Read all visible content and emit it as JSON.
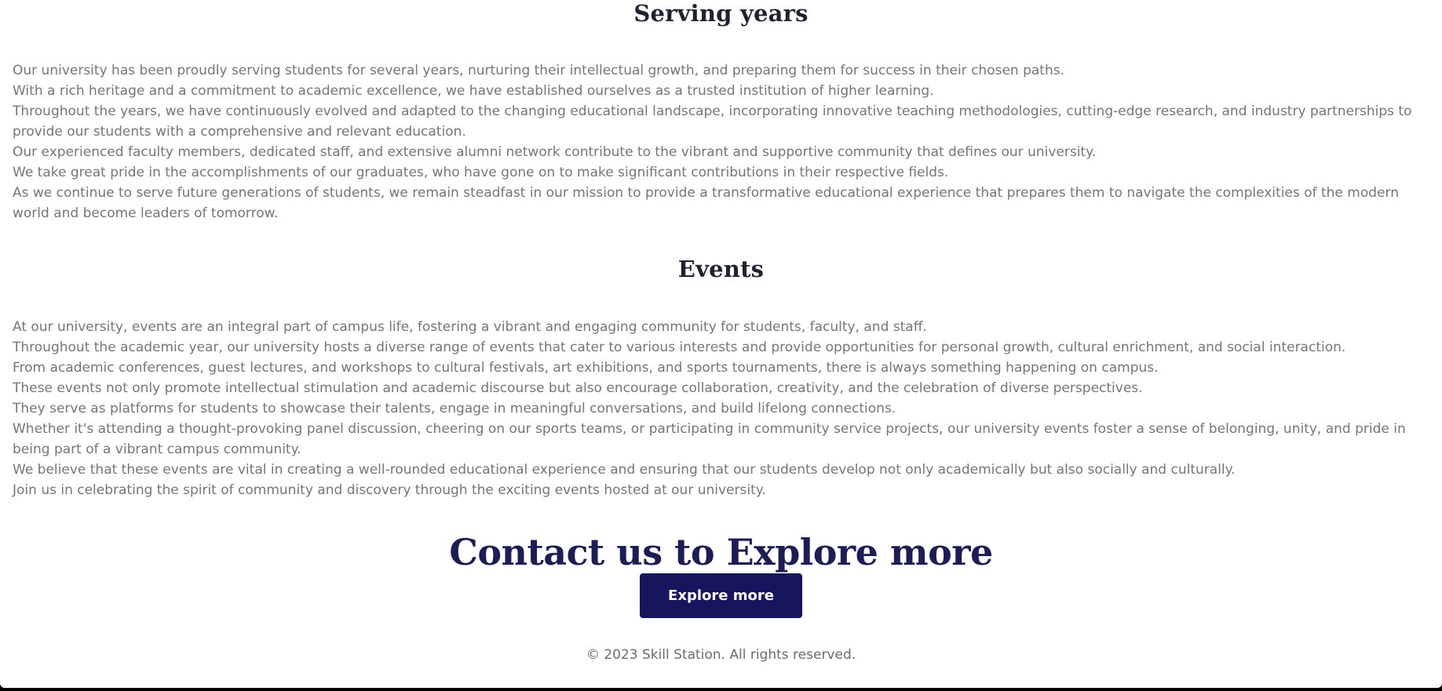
{
  "serving": {
    "title": "Serving years",
    "lines": [
      "Our university has been proudly serving students for several years, nurturing their intellectual growth, and preparing them for success in their chosen paths.",
      "With a rich heritage and a commitment to academic excellence, we have established ourselves as a trusted institution of higher learning.",
      "Throughout the years, we have continuously evolved and adapted to the changing educational landscape, incorporating innovative teaching methodologies, cutting-edge research, and industry partnerships to provide our students with a comprehensive and relevant education.",
      "Our experienced faculty members, dedicated staff, and extensive alumni network contribute to the vibrant and supportive community that defines our university.",
      "We take great pride in the accomplishments of our graduates, who have gone on to make significant contributions in their respective fields.",
      "As we continue to serve future generations of students, we remain steadfast in our mission to provide a transformative educational experience that prepares them to navigate the complexities of the modern world and become leaders of tomorrow."
    ]
  },
  "events": {
    "title": "Events",
    "lines": [
      "At our university, events are an integral part of campus life, fostering a vibrant and engaging community for students, faculty, and staff.",
      "Throughout the academic year, our university hosts a diverse range of events that cater to various interests and provide opportunities for personal growth, cultural enrichment, and social interaction.",
      "From academic conferences, guest lectures, and workshops to cultural festivals, art exhibitions, and sports tournaments, there is always something happening on campus.",
      "These events not only promote intellectual stimulation and academic discourse but also encourage collaboration, creativity, and the celebration of diverse perspectives.",
      "They serve as platforms for students to showcase their talents, engage in meaningful conversations, and build lifelong connections.",
      "Whether it's attending a thought-provoking panel discussion, cheering on our sports teams, or participating in community service projects, our university events foster a sense of belonging, unity, and pride in being part of a vibrant campus community.",
      "We believe that these events are vital in creating a well-rounded educational experience and ensuring that our students develop not only academically but also socially and culturally.",
      "Join us in celebrating the spirit of community and discovery through the exciting events hosted at our university."
    ]
  },
  "contact": {
    "title": "Contact us to Explore more",
    "button_label": "Explore more"
  },
  "footer": {
    "text": "© 2023 Skill Station. All rights reserved."
  },
  "colors": {
    "heading": "#1f2230",
    "contact_heading": "#1d1d55",
    "button_bg": "#16165f",
    "body_text": "#75757c"
  }
}
